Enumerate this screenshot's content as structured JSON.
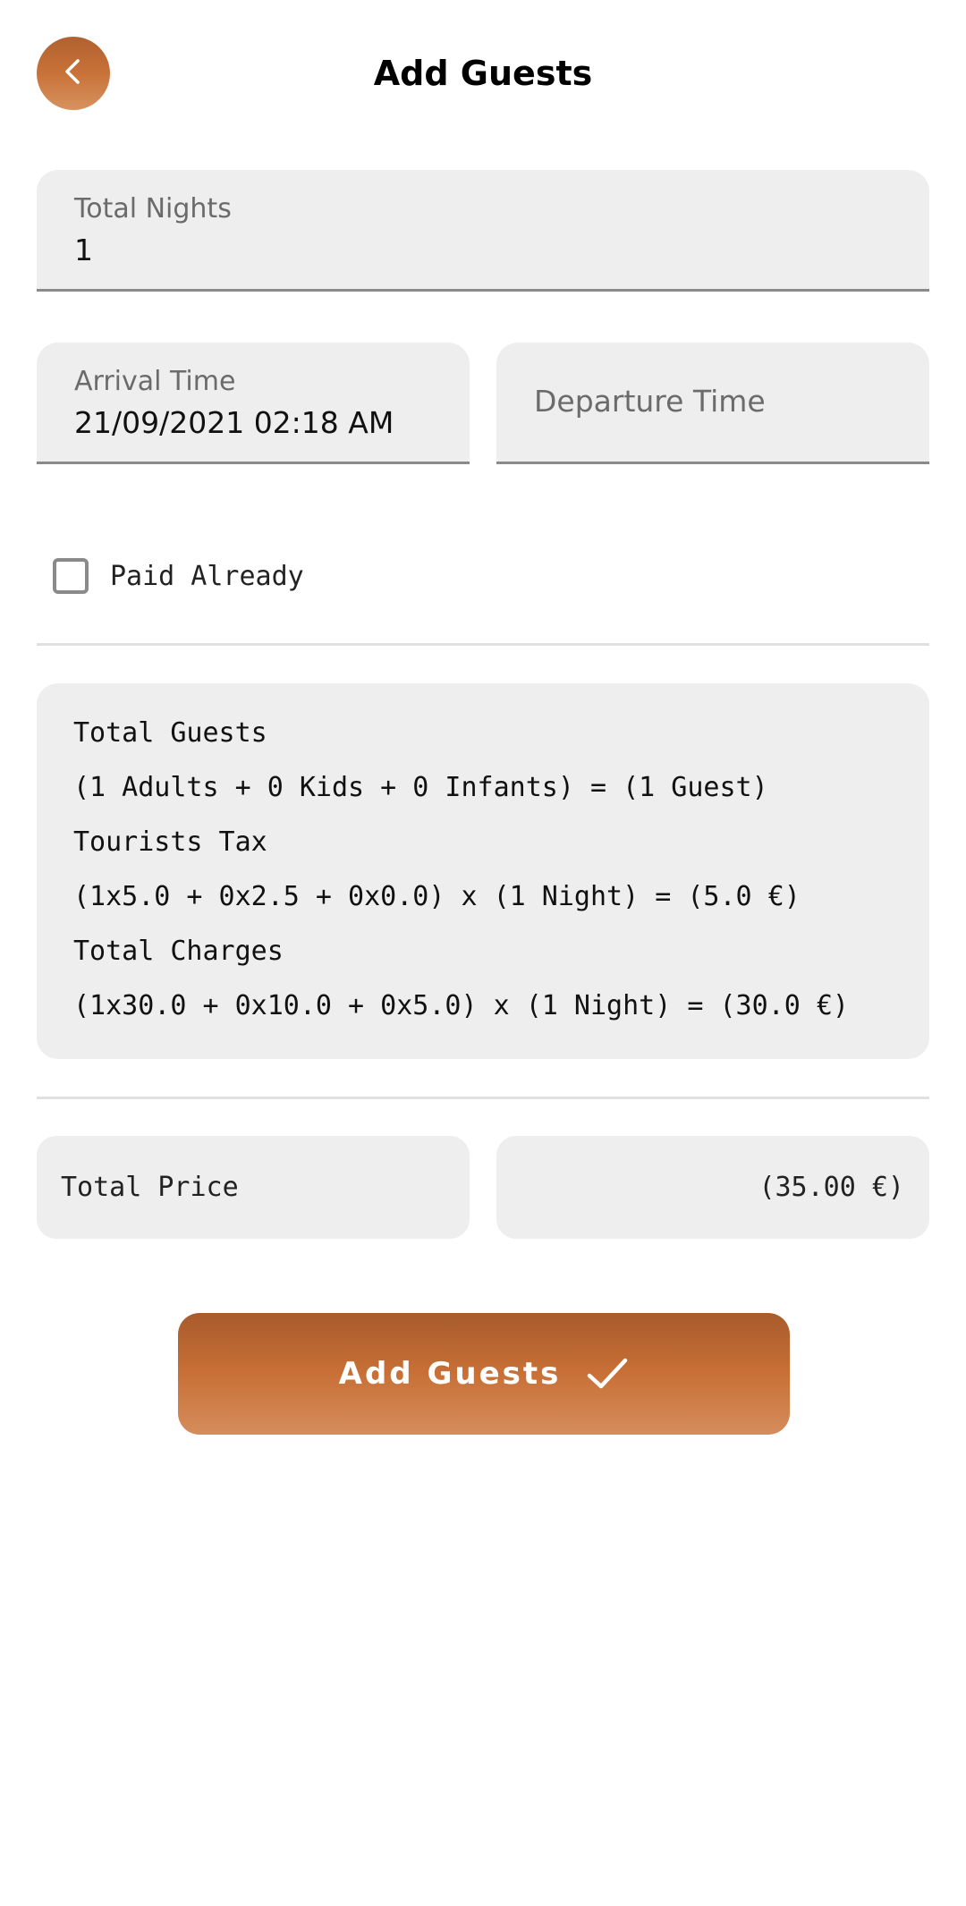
{
  "header": {
    "title": "Add Guests",
    "back_icon": "chevron-left-icon"
  },
  "form": {
    "total_nights": {
      "label": "Total Nights",
      "value": "1"
    },
    "arrival_time": {
      "label": "Arrival Time",
      "value": "21/09/2021 02:18 AM"
    },
    "departure_time": {
      "placeholder": "Departure Time"
    },
    "paid_already": {
      "label": "Paid Already",
      "checked": false
    }
  },
  "summary": {
    "total_guests_title": "Total Guests",
    "total_guests_detail": "(1 Adults + 0 Kids + 0 Infants) = (1 Guest)",
    "tourists_tax_title": "Tourists Tax",
    "tourists_tax_detail": "(1x5.0 + 0x2.5 + 0x0.0) x (1 Night) = (5.0 €)",
    "total_charges_title": "Total Charges",
    "total_charges_detail": "(1x30.0 + 0x10.0 + 0x5.0) x (1 Night) = (30.0 €)"
  },
  "total_price": {
    "label": "Total Price",
    "value": "(35.00 €)"
  },
  "add_button": {
    "label": "Add Guests",
    "icon": "check-icon"
  },
  "colors": {
    "accent": "#c87238",
    "field_background": "#eeeeee",
    "field_underline": "#8a8a8a"
  }
}
